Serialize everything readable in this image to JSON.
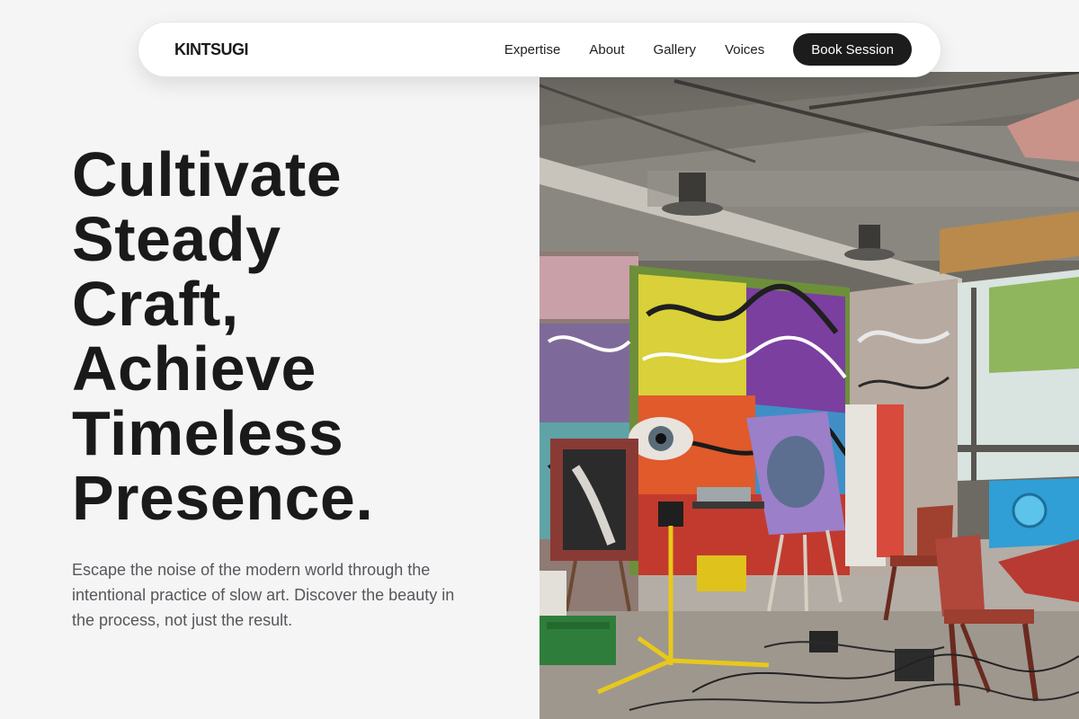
{
  "brand": {
    "logo": "KINTSUGI"
  },
  "nav": {
    "links": [
      "Expertise",
      "About",
      "Gallery",
      "Voices"
    ],
    "cta": "Book Session"
  },
  "hero": {
    "title_lines": [
      "Cultivate",
      "Steady",
      "Craft,",
      "Achieve",
      "Timeless",
      "Presence."
    ],
    "body": "Escape the noise of the modern world through the intentional practice of slow art. Discover the beauty in the process, not just the result.",
    "image_subject": "graffiti-covered art studio with easels, paintings, chairs and a tripod work light"
  },
  "colors": {
    "background": "#f5f5f5",
    "text": "#1a1a1a",
    "body_text": "#55575c",
    "cta_background": "#1c1c1c",
    "cta_text": "#ffffff",
    "nav_background": "#ffffff"
  }
}
